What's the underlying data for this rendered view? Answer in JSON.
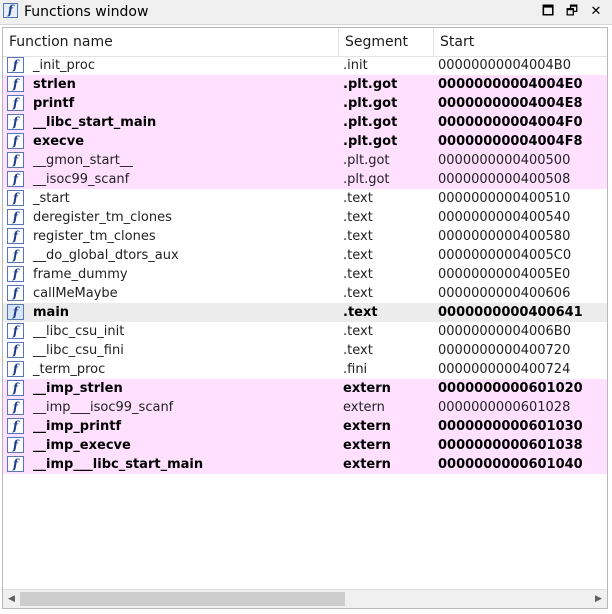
{
  "window": {
    "title": "Functions window",
    "icon": "f",
    "minimize_icon": "🗖",
    "restore_icon": "🗗",
    "close_icon": "✕"
  },
  "columns": {
    "name": "Function name",
    "segment": "Segment",
    "start": "Start"
  },
  "rows": [
    {
      "name": "_init_proc",
      "segment": ".init",
      "start": "00000000004004B0",
      "highlight": false,
      "bold": false
    },
    {
      "name": "strlen",
      "segment": ".plt.got",
      "start": "00000000004004E0",
      "highlight": true,
      "bold": true
    },
    {
      "name": "printf",
      "segment": ".plt.got",
      "start": "00000000004004E8",
      "highlight": true,
      "bold": true
    },
    {
      "name": "__libc_start_main",
      "segment": ".plt.got",
      "start": "00000000004004F0",
      "highlight": true,
      "bold": true
    },
    {
      "name": "execve",
      "segment": ".plt.got",
      "start": "00000000004004F8",
      "highlight": true,
      "bold": true
    },
    {
      "name": "__gmon_start__",
      "segment": ".plt.got",
      "start": "0000000000400500",
      "highlight": true,
      "bold": false
    },
    {
      "name": "__isoc99_scanf",
      "segment": ".plt.got",
      "start": "0000000000400508",
      "highlight": true,
      "bold": false
    },
    {
      "name": "_start",
      "segment": ".text",
      "start": "0000000000400510",
      "highlight": false,
      "bold": false
    },
    {
      "name": "deregister_tm_clones",
      "segment": ".text",
      "start": "0000000000400540",
      "highlight": false,
      "bold": false
    },
    {
      "name": "register_tm_clones",
      "segment": ".text",
      "start": "0000000000400580",
      "highlight": false,
      "bold": false
    },
    {
      "name": "__do_global_dtors_aux",
      "segment": ".text",
      "start": "00000000004005C0",
      "highlight": false,
      "bold": false
    },
    {
      "name": "frame_dummy",
      "segment": ".text",
      "start": "00000000004005E0",
      "highlight": false,
      "bold": false
    },
    {
      "name": "callMeMaybe",
      "segment": ".text",
      "start": "0000000000400606",
      "highlight": false,
      "bold": false
    },
    {
      "name": "main",
      "segment": ".text",
      "start": "0000000000400641",
      "highlight": false,
      "bold": true,
      "selected": true
    },
    {
      "name": "__libc_csu_init",
      "segment": ".text",
      "start": "00000000004006B0",
      "highlight": false,
      "bold": false
    },
    {
      "name": "__libc_csu_fini",
      "segment": ".text",
      "start": "0000000000400720",
      "highlight": false,
      "bold": false
    },
    {
      "name": "_term_proc",
      "segment": ".fini",
      "start": "0000000000400724",
      "highlight": false,
      "bold": false
    },
    {
      "name": "__imp_strlen",
      "segment": "extern",
      "start": "0000000000601020",
      "highlight": true,
      "bold": true
    },
    {
      "name": "__imp___isoc99_scanf",
      "segment": "extern",
      "start": "0000000000601028",
      "highlight": true,
      "bold": false
    },
    {
      "name": "__imp_printf",
      "segment": "extern",
      "start": "0000000000601030",
      "highlight": true,
      "bold": true
    },
    {
      "name": "__imp_execve",
      "segment": "extern",
      "start": "0000000000601038",
      "highlight": true,
      "bold": true
    },
    {
      "name": "__imp___libc_start_main",
      "segment": "extern",
      "start": "0000000000601040",
      "highlight": true,
      "bold": true
    }
  ],
  "colors": {
    "highlight": "#ffe1ff",
    "selected": "#ececec",
    "icon_border": "#5577b5"
  }
}
